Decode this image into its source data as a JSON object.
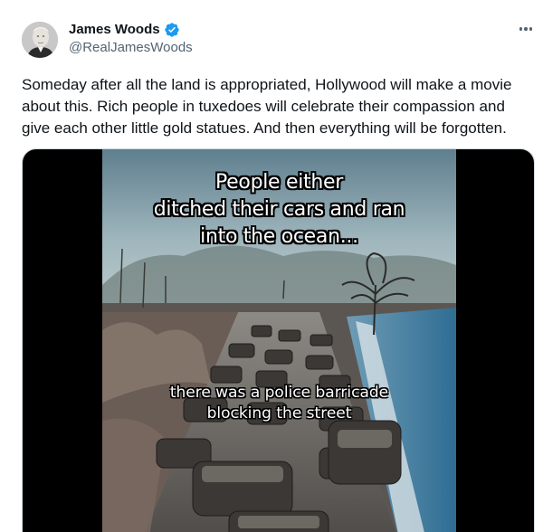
{
  "author": {
    "display_name": "James Woods",
    "handle": "@RealJamesWoods",
    "verified": true,
    "avatar_icon": "avatar-portrait",
    "verified_color": "#1d9bf0"
  },
  "menu": {
    "more_icon": "more-horizontal-icon"
  },
  "tweet": {
    "text": "Someday after all the land is appropriated, Hollywood will make a movie\nabout this. Rich people in tuxedoes will celebrate their compassion and\ngive each other little gold statues. And then everything will be forgotten."
  },
  "video": {
    "caption_top": "People either\nditched their cars and ran\ninto the ocean...",
    "caption_bottom": "there was a police barricade\nblocking the street"
  },
  "colors": {
    "text_primary": "#0f1419",
    "text_secondary": "#536471",
    "media_background": "#000000"
  }
}
